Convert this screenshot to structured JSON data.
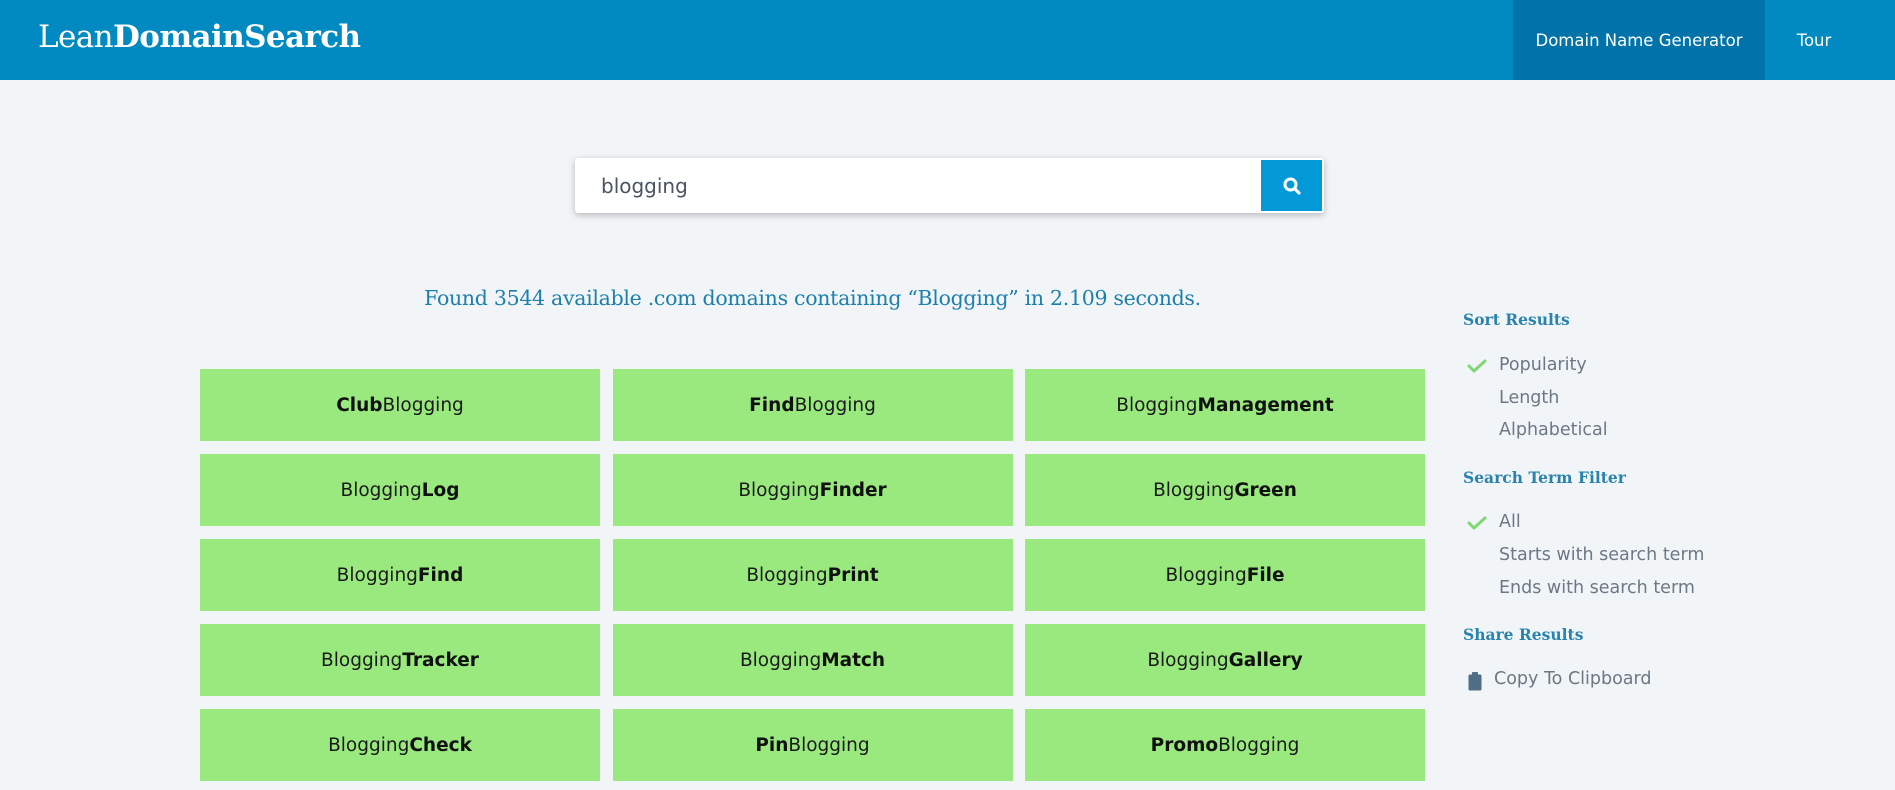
{
  "header": {
    "logo_light": "Lean",
    "logo_bold": "DomainSearch",
    "nav": [
      {
        "label": "Domain Name Generator",
        "active": true
      },
      {
        "label": "Tour",
        "active": false
      }
    ]
  },
  "search": {
    "value": "blogging",
    "placeholder": "",
    "button_icon": "search-icon"
  },
  "results": {
    "summary": "Found 3544 available .com domains containing “Blogging” in 2.109 seconds.",
    "count": 3544,
    "term": "Blogging",
    "seconds": "2.109",
    "domains": [
      {
        "prefix": "Club",
        "prefix_bold": true,
        "suffix": "Blogging",
        "suffix_bold": false
      },
      {
        "prefix": "Find",
        "prefix_bold": true,
        "suffix": "Blogging",
        "suffix_bold": false
      },
      {
        "prefix": "Blogging",
        "prefix_bold": false,
        "suffix": "Management",
        "suffix_bold": true
      },
      {
        "prefix": "Blogging",
        "prefix_bold": false,
        "suffix": "Log",
        "suffix_bold": true
      },
      {
        "prefix": "Blogging",
        "prefix_bold": false,
        "suffix": "Finder",
        "suffix_bold": true
      },
      {
        "prefix": "Blogging",
        "prefix_bold": false,
        "suffix": "Green",
        "suffix_bold": true
      },
      {
        "prefix": "Blogging",
        "prefix_bold": false,
        "suffix": "Find",
        "suffix_bold": true
      },
      {
        "prefix": "Blogging",
        "prefix_bold": false,
        "suffix": "Print",
        "suffix_bold": true
      },
      {
        "prefix": "Blogging",
        "prefix_bold": false,
        "suffix": "File",
        "suffix_bold": true
      },
      {
        "prefix": "Blogging",
        "prefix_bold": false,
        "suffix": "Tracker",
        "suffix_bold": true
      },
      {
        "prefix": "Blogging",
        "prefix_bold": false,
        "suffix": "Match",
        "suffix_bold": true
      },
      {
        "prefix": "Blogging",
        "prefix_bold": false,
        "suffix": "Gallery",
        "suffix_bold": true
      },
      {
        "prefix": "Blogging",
        "prefix_bold": false,
        "suffix": "Check",
        "suffix_bold": true
      },
      {
        "prefix": "Pin",
        "prefix_bold": true,
        "suffix": "Blogging",
        "suffix_bold": false
      },
      {
        "prefix": "Promo",
        "prefix_bold": true,
        "suffix": "Blogging",
        "suffix_bold": false
      }
    ]
  },
  "sidebar": {
    "sort": {
      "heading": "Sort Results",
      "options": [
        {
          "label": "Popularity",
          "selected": true
        },
        {
          "label": "Length",
          "selected": false
        },
        {
          "label": "Alphabetical",
          "selected": false
        }
      ]
    },
    "filter": {
      "heading": "Search Term Filter",
      "options": [
        {
          "label": "All",
          "selected": true
        },
        {
          "label": "Starts with search term",
          "selected": false
        },
        {
          "label": "Ends with search term",
          "selected": false
        }
      ]
    },
    "share": {
      "heading": "Share Results",
      "copy_label": "Copy To Clipboard",
      "copy_icon": "clipboard-icon"
    }
  },
  "colors": {
    "header_bg": "#0189c2",
    "nav_active_bg": "#0173a8",
    "search_button": "#0399d6",
    "result_cell": "#99e97f",
    "summary_text": "#1e7faa",
    "sidebar_heading": "#2a83ac",
    "check": "#7fd672"
  }
}
